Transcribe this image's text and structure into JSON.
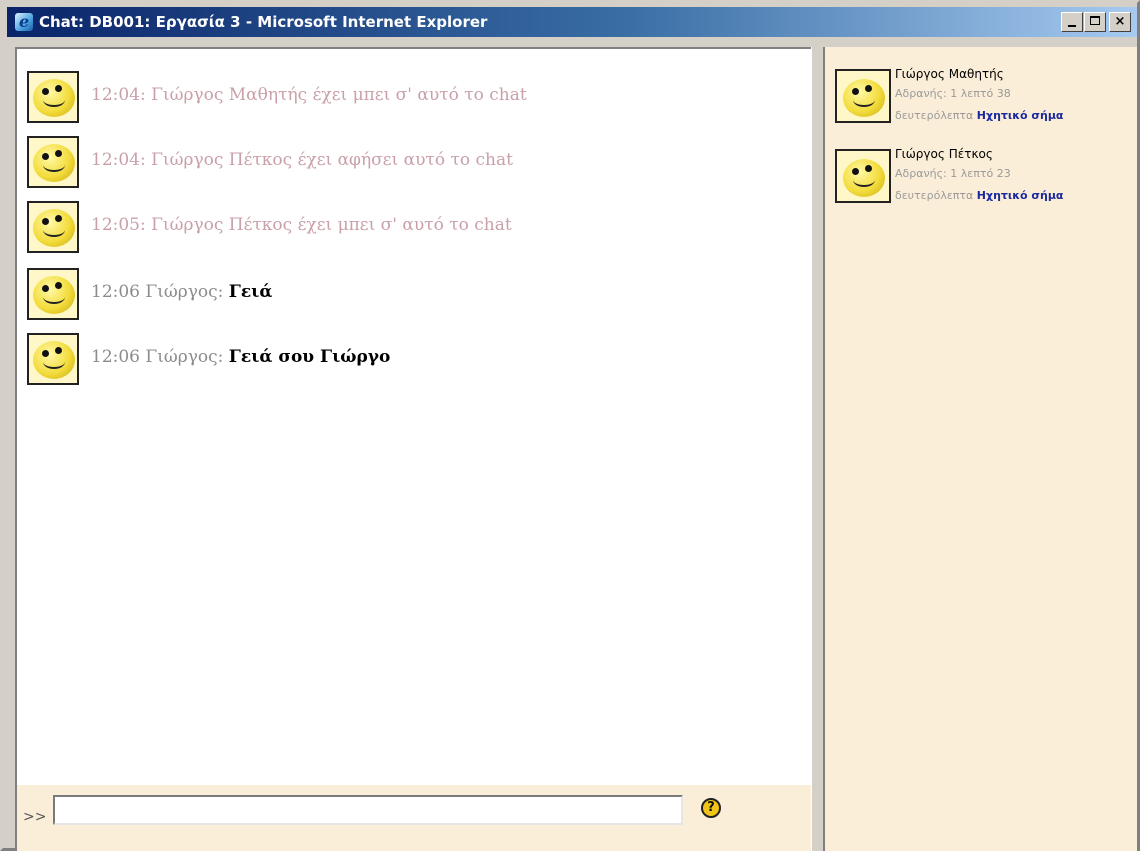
{
  "window": {
    "title": "Chat: DB001: Εργασία 3 - Microsoft Internet Explorer",
    "min_glyph": "_",
    "max_glyph": "□",
    "close_glyph": "×"
  },
  "messages": [
    {
      "kind": "system",
      "text": "12:04: Γιώργος Μαθητής έχει μπει σ' αυτό το chat"
    },
    {
      "kind": "system",
      "text": "12:04: Γιώργος Πέτκος έχει αφήσει αυτό το chat"
    },
    {
      "kind": "system",
      "text": "12:05: Γιώργος Πέτκος έχει μπει σ' αυτό το chat"
    },
    {
      "kind": "user",
      "time": "12:06",
      "who": "Γιώργος:",
      "body": "Γειά"
    },
    {
      "kind": "user",
      "time": "12:06",
      "who": "Γιώργος:",
      "body": "Γειά σου Γιώργο"
    }
  ],
  "input": {
    "prompt": ">>",
    "value": "",
    "help_glyph": "?"
  },
  "users": [
    {
      "name": "Γιώργος Μαθητής",
      "idle_label": "Αδρανής:",
      "idle_value": "1 λεπτό 38",
      "seconds_label": "δευτερόλεπτα",
      "beep_label": "Ηχητικό σήμα"
    },
    {
      "name": "Γιώργος Πέτκος",
      "idle_label": "Αδρανής:",
      "idle_value": "1 λεπτό 23",
      "seconds_label": "δευτερόλεπτα",
      "beep_label": "Ηχητικό σήμα"
    }
  ],
  "icons": {
    "title": "ie-icon",
    "avatar": "smiley-icon",
    "help": "help-icon"
  },
  "colors": {
    "system_text": "#c9a0a8",
    "meta_text": "#8c8c8c",
    "user_pane_bg": "#fbeed8",
    "beep_link": "#1a2a9c"
  }
}
